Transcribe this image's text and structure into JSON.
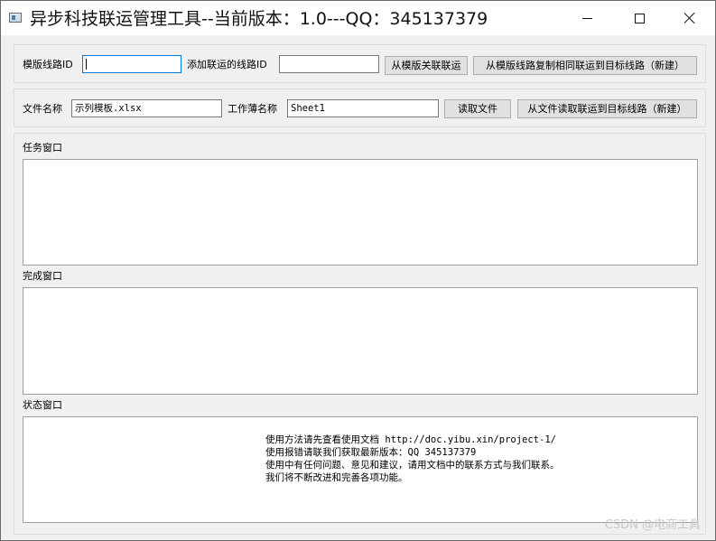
{
  "window": {
    "title": "异步科技联运管理工具--当前版本：1.0---QQ：345137379"
  },
  "template_row": {
    "template_route_label": "模版线路ID",
    "template_route_value": "",
    "add_route_label": "添加联运的线路ID",
    "add_route_value": "",
    "link_from_template_button": "从模版关联联运",
    "copy_to_target_button": "从模版线路复制相同联运到目标线路（新建）"
  },
  "file_row": {
    "file_name_label": "文件名称",
    "file_name_value": "示列模板.xlsx",
    "sheet_name_label": "工作薄名称",
    "sheet_name_value": "Sheet1",
    "read_file_button": "读取文件",
    "read_to_target_button": "从文件读取联运到目标线路（新建）"
  },
  "task_panel": {
    "label": "任务窗口"
  },
  "done_panel": {
    "label": "完成窗口"
  },
  "status_panel": {
    "label": "状态窗口",
    "lines": [
      "使用方法请先查看使用文档  http://doc.yibu.xin/project-1/",
      "使用报错请联我们获取最新版本：QQ 345137379",
      "使用中有任何问题、意见和建议，请用文档中的联系方式与我们联系。",
      "我们将不断改进和完善各项功能。"
    ]
  },
  "watermark": "CSDN @电商工具"
}
